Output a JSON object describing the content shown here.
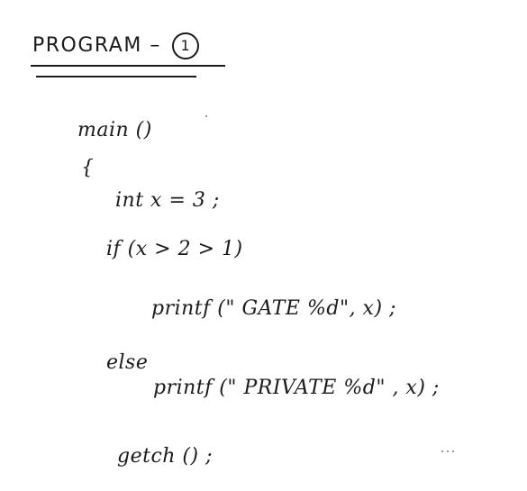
{
  "header": {
    "title": "PROGRAM –",
    "number": "1"
  },
  "code": {
    "line1": "main ()",
    "line2": "{",
    "line3": "int  x = 3 ;",
    "line4": "if  (x > 2 > 1)",
    "line5": "printf  (\" GATE %d\", x) ;",
    "line6": "else",
    "line7": "printf  (\" PRIVATE %d\" , x) ;",
    "line8": "getch () ;"
  },
  "colors": {
    "ink": "#1b1b1b",
    "background": "#ffffff"
  }
}
